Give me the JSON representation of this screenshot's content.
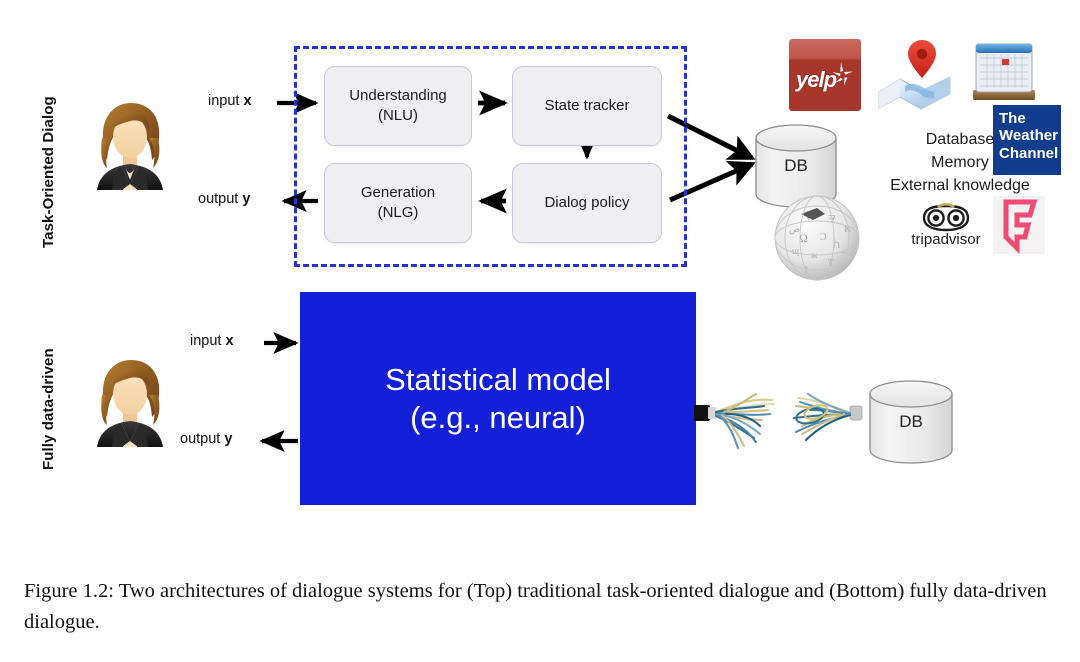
{
  "figure": {
    "rows": {
      "top_label": "Task-Oriented Dialog",
      "bottom_label": "Fully data-driven"
    },
    "io": {
      "input_prefix": "input ",
      "input_var": "x",
      "output_prefix": "output ",
      "output_var": "y"
    },
    "pipeline": {
      "nlu": {
        "line1": "Understanding",
        "line2": "(NLU)"
      },
      "state_tracker": {
        "line1": "State tracker",
        "line2": ""
      },
      "dialog_policy": {
        "line1": "Dialog policy",
        "line2": ""
      },
      "nlg": {
        "line1": "Generation",
        "line2": "(NLG)"
      }
    },
    "statistical_model": {
      "line1": "Statistical model",
      "line2": "(e.g., neural)",
      "color": "#1320d8",
      "text_color": "#ffffff"
    },
    "databases": {
      "top_label": "DB",
      "bottom_label": "DB"
    },
    "knowledge": {
      "lines": [
        "Database",
        "Memory",
        "External knowledge"
      ]
    },
    "logos": [
      {
        "name": "yelp",
        "word": "yelp",
        "color": "#a8372b"
      },
      {
        "name": "maps-pin",
        "word": "",
        "color": "#e03a2f"
      },
      {
        "name": "calendar",
        "word": "",
        "color": "#3a7bd5"
      },
      {
        "name": "the-weather-channel",
        "line1": "The",
        "line2": "Weather",
        "line3": "Channel",
        "color": "#123d8f"
      },
      {
        "name": "wikipedia",
        "word": "",
        "color": "#dcdcdc"
      },
      {
        "name": "tripadvisor",
        "word": "tripadvisor",
        "mark": "®",
        "color": "#1d1d1d"
      },
      {
        "name": "foursquare",
        "word": "",
        "color": "#ef4b74"
      }
    ],
    "caption": "Figure 1.2: Two architectures of dialogue systems for (Top) traditional task-oriented dialogue and (Bottom) fully data-driven dialogue."
  },
  "colors": {
    "dashed_border": "#2432d6",
    "box_fill": "#eeeef3",
    "box_border": "#c9c6dd",
    "arrow": "#000000"
  }
}
